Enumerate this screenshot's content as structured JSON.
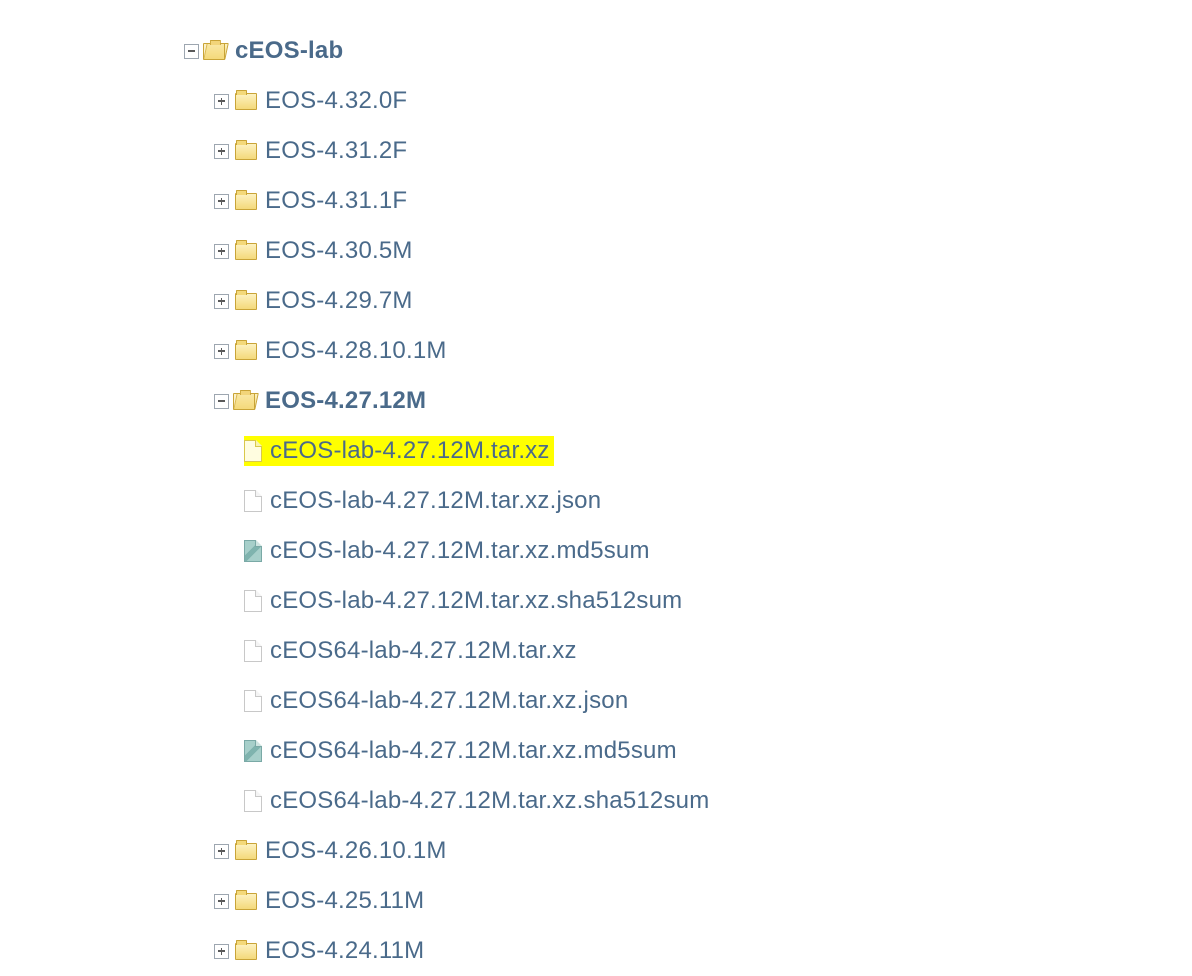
{
  "tree": {
    "root": {
      "label": "cEOS-lab"
    },
    "folders_before": [
      {
        "label": "EOS-4.32.0F"
      },
      {
        "label": "EOS-4.31.2F"
      },
      {
        "label": "EOS-4.31.1F"
      },
      {
        "label": "EOS-4.30.5M"
      },
      {
        "label": "EOS-4.29.7M"
      },
      {
        "label": "EOS-4.28.10.1M"
      }
    ],
    "open_folder": {
      "label": "EOS-4.27.12M"
    },
    "files": [
      {
        "label": "cEOS-lab-4.27.12M.tar.xz",
        "icon": "yellow",
        "highlighted": true
      },
      {
        "label": "cEOS-lab-4.27.12M.tar.xz.json",
        "icon": "plain",
        "highlighted": false
      },
      {
        "label": "cEOS-lab-4.27.12M.tar.xz.md5sum",
        "icon": "teal",
        "highlighted": false
      },
      {
        "label": "cEOS-lab-4.27.12M.tar.xz.sha512sum",
        "icon": "plain",
        "highlighted": false
      },
      {
        "label": "cEOS64-lab-4.27.12M.tar.xz",
        "icon": "plain",
        "highlighted": false
      },
      {
        "label": "cEOS64-lab-4.27.12M.tar.xz.json",
        "icon": "plain",
        "highlighted": false
      },
      {
        "label": "cEOS64-lab-4.27.12M.tar.xz.md5sum",
        "icon": "teal",
        "highlighted": false
      },
      {
        "label": "cEOS64-lab-4.27.12M.tar.xz.sha512sum",
        "icon": "plain",
        "highlighted": false
      }
    ],
    "folders_after": [
      {
        "label": "EOS-4.26.10.1M"
      },
      {
        "label": "EOS-4.25.11M"
      },
      {
        "label": "EOS-4.24.11M"
      }
    ]
  }
}
